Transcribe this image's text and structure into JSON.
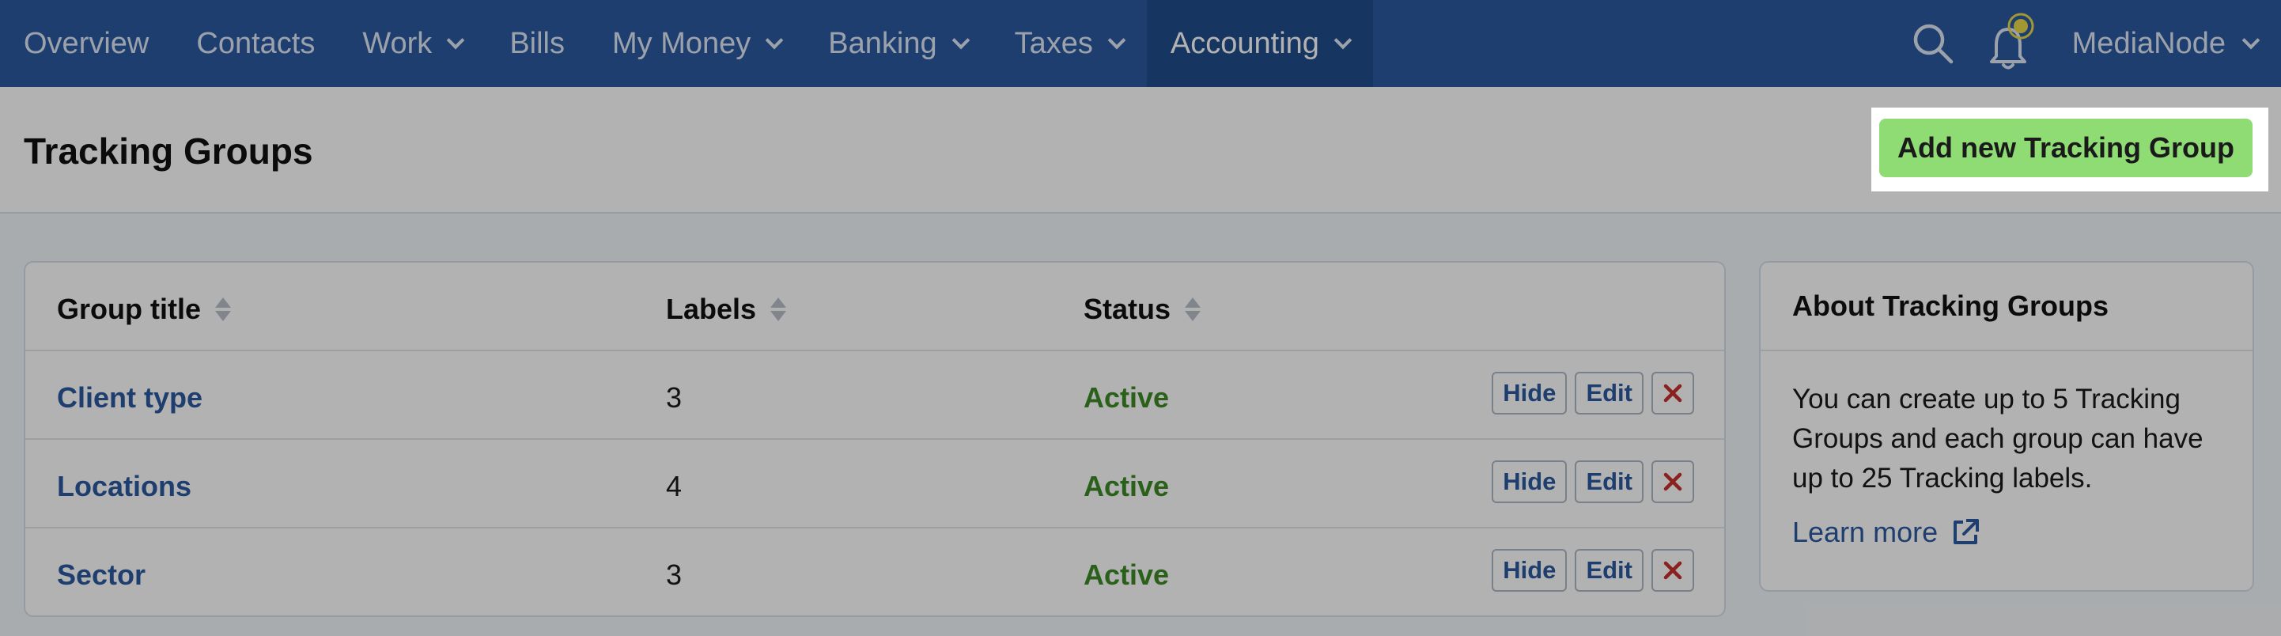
{
  "nav": {
    "items": [
      {
        "label": "Overview",
        "dropdown": false
      },
      {
        "label": "Contacts",
        "dropdown": false
      },
      {
        "label": "Work",
        "dropdown": true
      },
      {
        "label": "Bills",
        "dropdown": false
      },
      {
        "label": "My Money",
        "dropdown": true
      },
      {
        "label": "Banking",
        "dropdown": true
      },
      {
        "label": "Taxes",
        "dropdown": true
      },
      {
        "label": "Accounting",
        "dropdown": true,
        "active": true
      }
    ],
    "search_icon": "search-icon",
    "notifications_icon": "bell-icon",
    "user_name": "MediaNode"
  },
  "page": {
    "title": "Tracking Groups",
    "add_button_label": "Add new Tracking Group"
  },
  "table": {
    "headers": {
      "group_title": "Group title",
      "labels": "Labels",
      "status": "Status"
    },
    "rows": [
      {
        "title": "Client type",
        "labels": "3",
        "status": "Active"
      },
      {
        "title": "Locations",
        "labels": "4",
        "status": "Active"
      },
      {
        "title": "Sector",
        "labels": "3",
        "status": "Active"
      }
    ],
    "actions": {
      "hide": "Hide",
      "edit": "Edit",
      "delete": "✕"
    }
  },
  "about": {
    "title": "About Tracking Groups",
    "text": "You can create up to 5 Tracking Groups and each group can have up to 25 Tracking labels.",
    "link_label": "Learn more"
  },
  "colors": {
    "nav_bg": "#2c5aa0",
    "primary_button": "#8fdc75",
    "link": "#2c5aa0",
    "status_active": "#3d8a26",
    "delete": "#c8302c",
    "notification_dot": "#e8d84a"
  }
}
